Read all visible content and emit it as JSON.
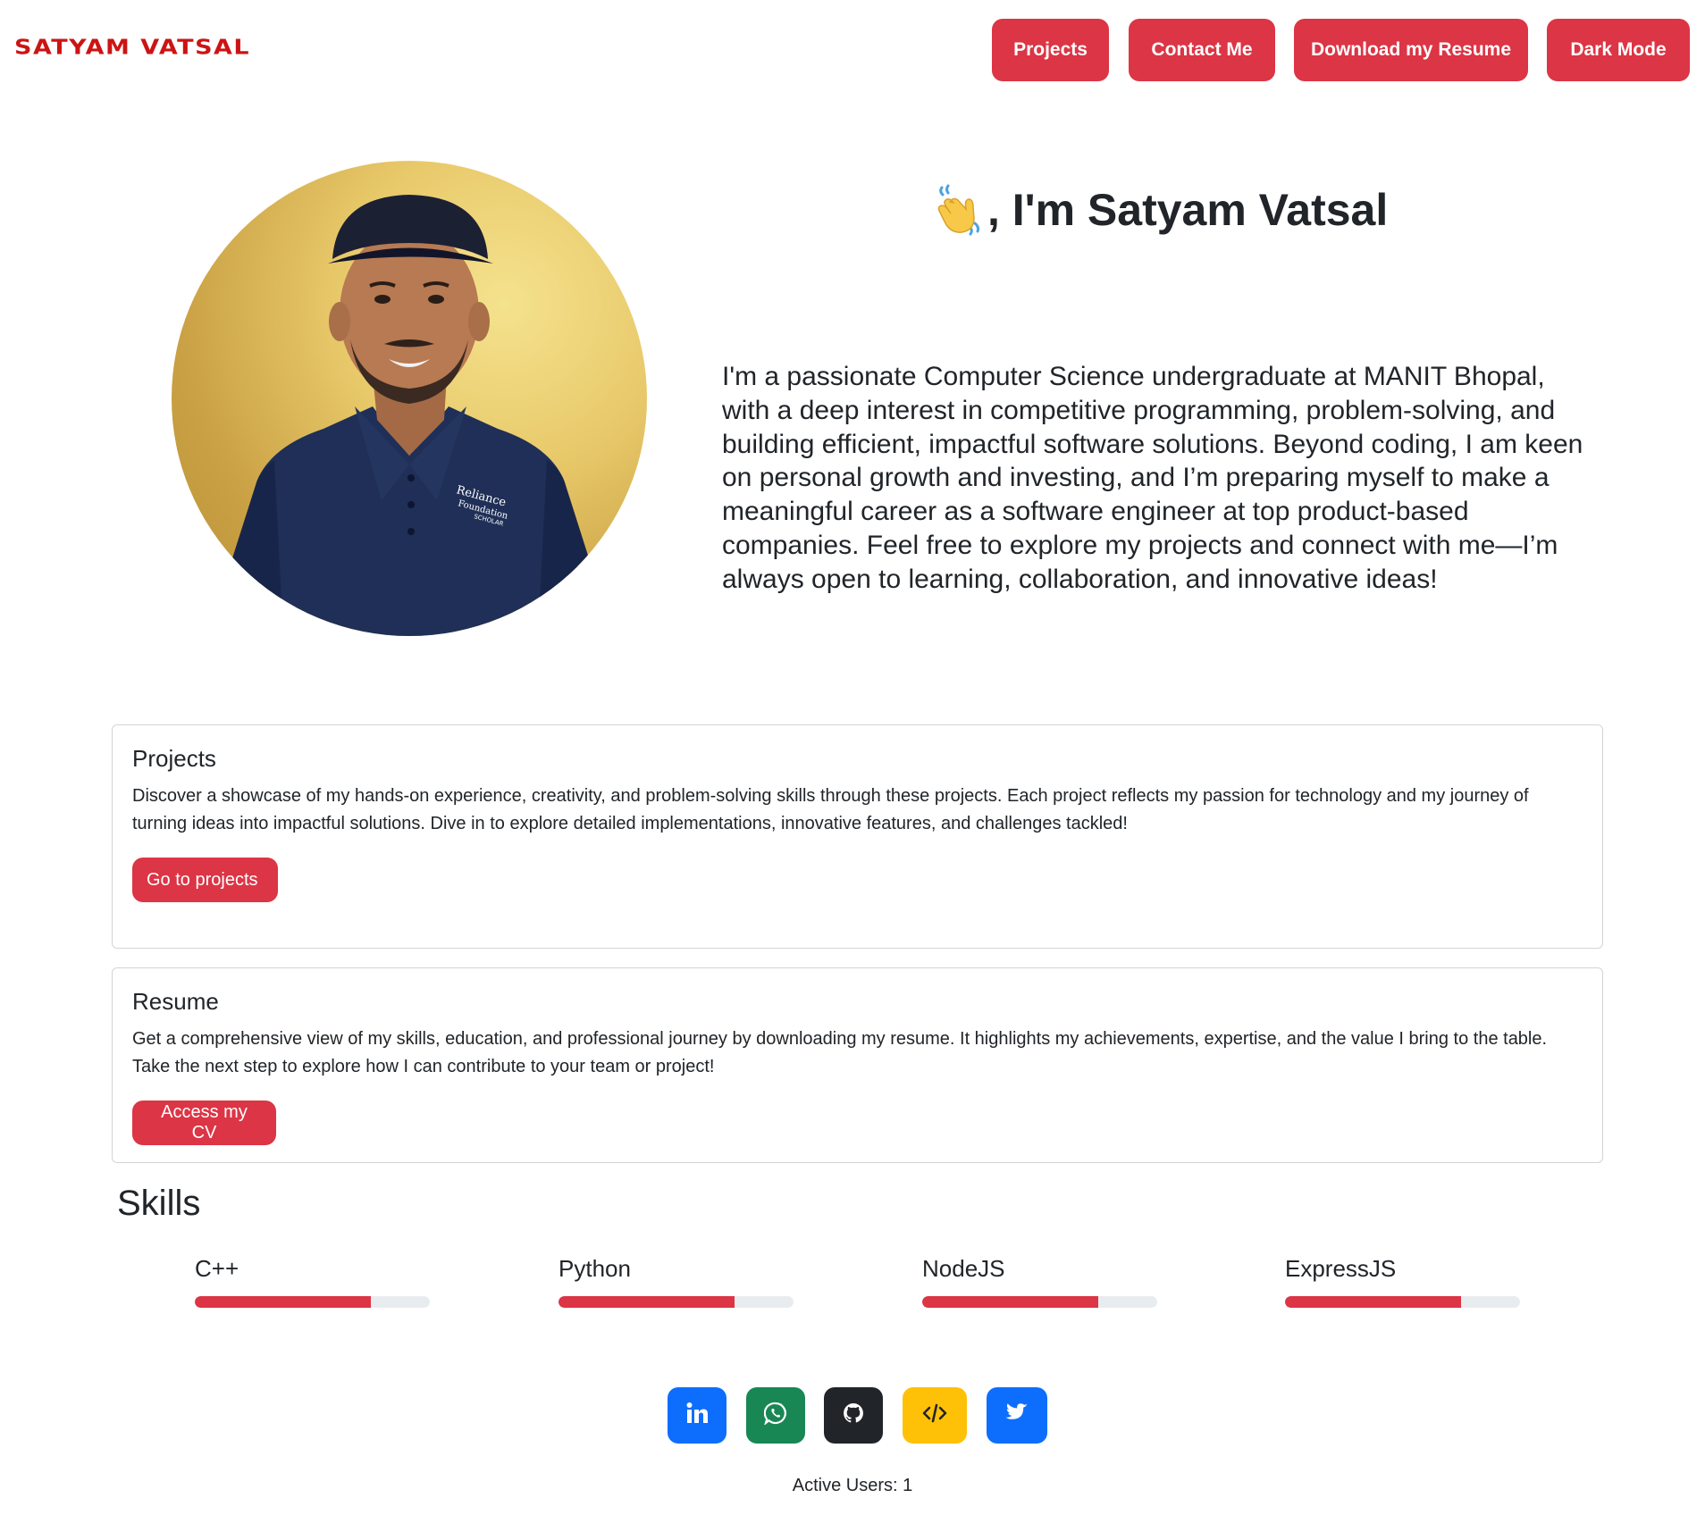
{
  "header": {
    "brand": "SATYAM VATSAL",
    "nav": {
      "projects": "Projects",
      "contact": "Contact Me",
      "resume": "Download my Resume",
      "dark_mode": "Dark Mode"
    }
  },
  "hero": {
    "greeting_icon": "waving-hand-icon",
    "title": ", I'm Satyam Vatsal",
    "bio": "I'm a passionate Computer Science undergraduate at MANIT Bhopal, with a deep interest in competitive programming, problem-solving, and building efficient, impactful software solutions. Beyond coding, I am keen on personal growth and investing, and I’m preparing myself to make a meaningful career as a software engineer at top product-based companies. Feel free to explore my projects and connect with me—I’m always open to learning, collaboration, and innovative ideas!",
    "shirt_logo": "Reliance Foundation SCHOLAR"
  },
  "cards": {
    "projects": {
      "title": "Projects",
      "text": "Discover a showcase of my hands-on experience, creativity, and problem-solving skills through these projects. Each project reflects my passion for technology and my journey of turning ideas into impactful solutions. Dive in to explore detailed implementations, innovative features, and challenges tackled!",
      "button": "Go to projects"
    },
    "resume": {
      "title": "Resume",
      "text": "Get a comprehensive view of my skills, education, and professional journey by downloading my resume. It highlights my achievements, expertise, and the value I bring to the table. Take the next step to explore how I can contribute to your team or project!",
      "button": "Access my CV"
    }
  },
  "skills": {
    "title": "Skills",
    "items": [
      {
        "name": "C++",
        "level": 0.75
      },
      {
        "name": "Python",
        "level": 0.75
      },
      {
        "name": "NodeJS",
        "level": 0.75
      },
      {
        "name": "ExpressJS",
        "level": 0.75
      }
    ]
  },
  "social": {
    "links": [
      {
        "icon": "linkedin-icon",
        "color": "#0d6efd"
      },
      {
        "icon": "whatsapp-icon",
        "color": "#198754"
      },
      {
        "icon": "github-icon",
        "color": "#212529"
      },
      {
        "icon": "code-icon",
        "color": "#ffc107"
      },
      {
        "icon": "twitter-icon",
        "color": "#0d6efd"
      }
    ]
  },
  "footer": {
    "active_users": "Active Users: 1"
  },
  "colors": {
    "accent": "#dc3545",
    "brand": "#cc1414",
    "text": "#212529"
  }
}
